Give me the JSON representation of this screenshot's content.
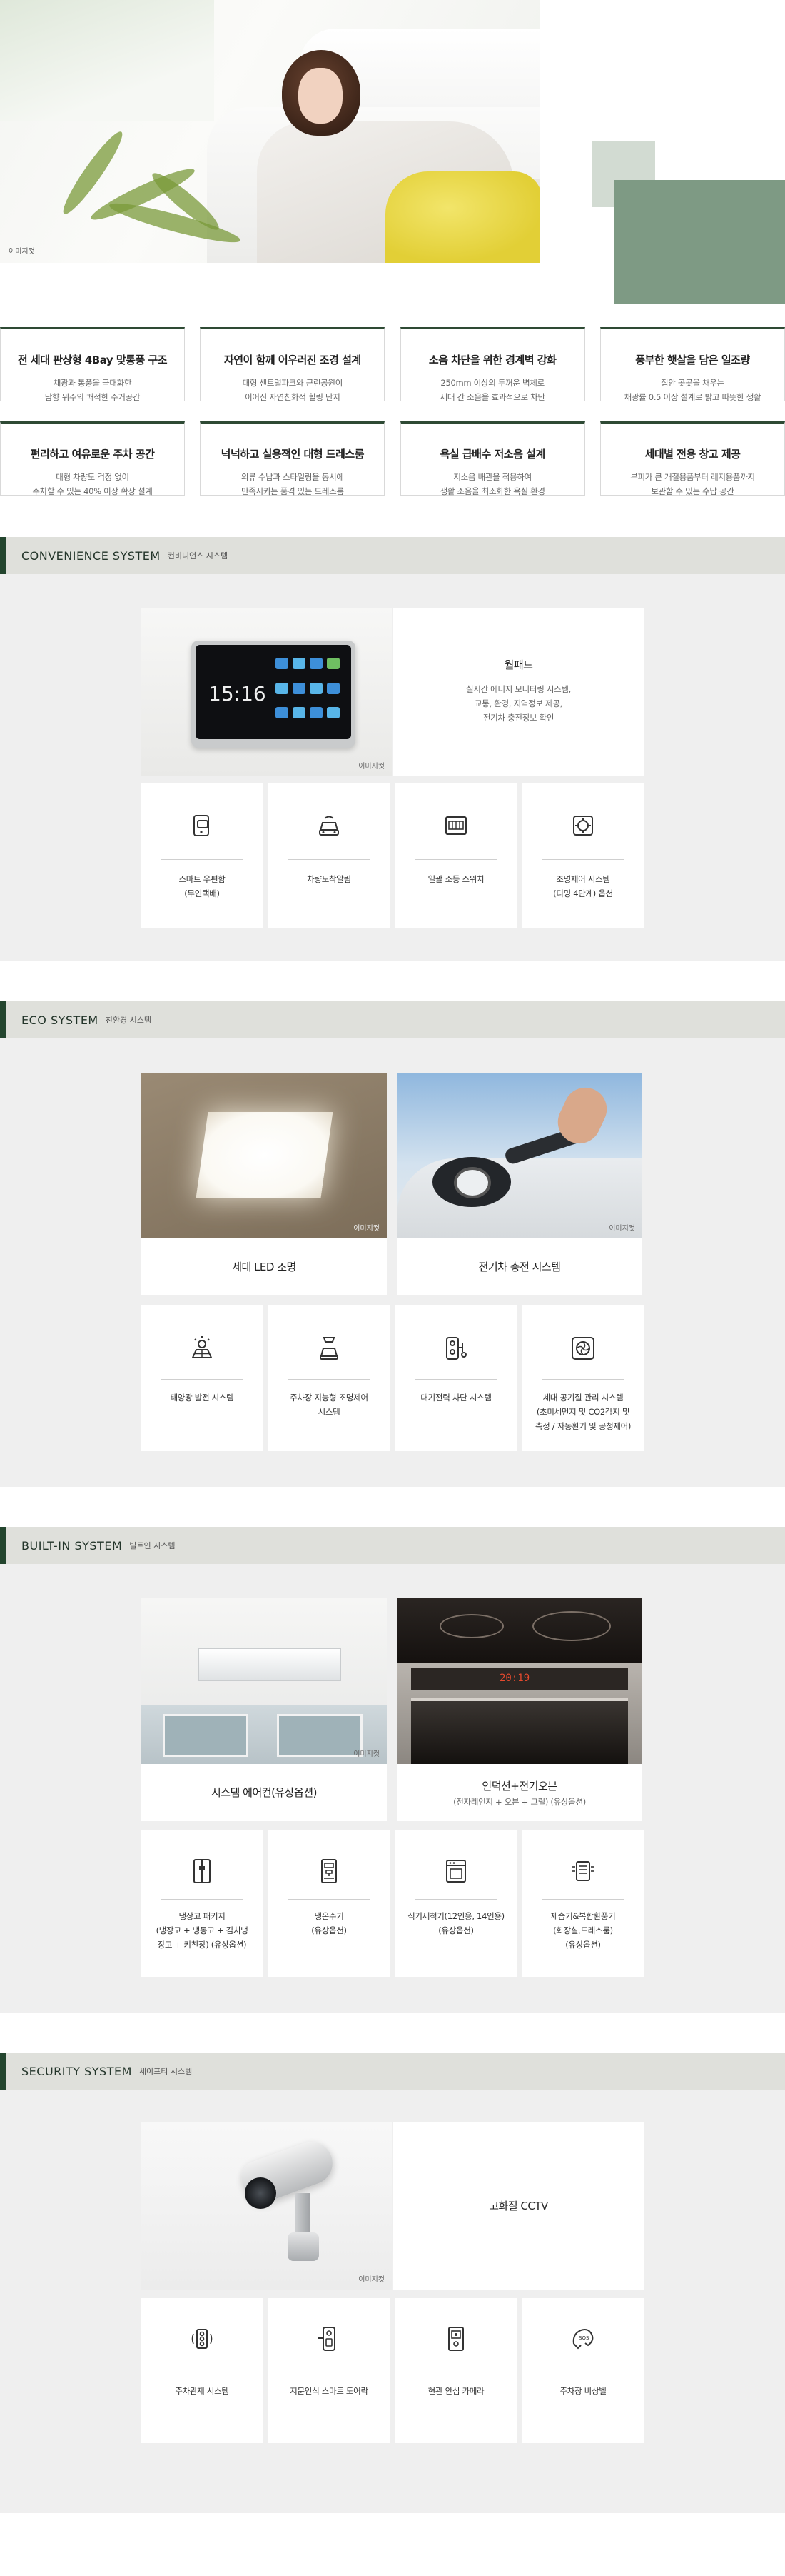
{
  "hero": {
    "image_caption": "이미지컷"
  },
  "features": {
    "row1": [
      {
        "title": "전 세대 판상형 4Bay 맞통풍 구조",
        "desc": "채광과 통풍을 극대화한\n남향 위주의 쾌적한 주거공간"
      },
      {
        "title": "자연이 함께 어우러진 조경 설계",
        "desc": "대형 센트럴파크와 근린공원이\n이어진 자연친화적 힐링 단지"
      },
      {
        "title": "소음 차단을 위한 경계벽 강화",
        "desc": "250mm 이상의 두꺼운 벽체로\n세대 간 소음을 효과적으로 차단"
      },
      {
        "title": "풍부한 햇살을 담은 일조량",
        "desc": "집안 곳곳을 채우는\n채광률 0.5 이상 설계로 밝고 따뜻한 생활"
      }
    ],
    "row2": [
      {
        "title": "편리하고 여유로운 주차 공간",
        "desc": "대형 차량도 걱정 없이\n주차할 수 있는 40% 이상 확장 설계"
      },
      {
        "title": "넉넉하고 실용적인 대형 드레스룸",
        "desc": "의류 수납과 스타일링을 동시에\n만족시키는 품격 있는 드레스룸"
      },
      {
        "title": "욕실 급배수 저소음 설계",
        "desc": "저소음 배관을 적용하여\n생활 소음을 최소화한 욕실 환경"
      },
      {
        "title": "세대별 전용 창고 제공",
        "desc": "부피가 큰 개절용품부터 레저용품까지\n보관할 수 있는 수납 공간"
      }
    ]
  },
  "convenience": {
    "title_en": "CONVENIENCE SYSTEM",
    "title_ko": "컨비니언스 시스템",
    "wallpad": {
      "screen_time": "15:16",
      "caption": "이미지컷",
      "title": "월패드",
      "desc": "실시간 에너지 모니터링 시스템,\n교통, 환경, 지역정보 제공,\n전기차 충전정보 확인"
    },
    "icons": [
      {
        "icon": "smart-mailbox-icon",
        "label": "스마트 우편함\n(무인택배)"
      },
      {
        "icon": "car-arrival-icon",
        "label": "차량도착알림"
      },
      {
        "icon": "standby-switch-icon",
        "label": "일괄 소등 스위치"
      },
      {
        "icon": "room-control-icon",
        "label": "조명제어 시스템\n(디밍 4단계) 옵션"
      }
    ]
  },
  "eco": {
    "title_en": "ECO SYSTEM",
    "title_ko": "친환경 시스템",
    "features": [
      {
        "label": "세대 LED 조명",
        "caption": "이미지컷"
      },
      {
        "label": "전기차 충전 시스템",
        "caption": "이미지컷"
      }
    ],
    "icons": [
      {
        "icon": "solar-power-icon",
        "label": "태양광 발전 시스템"
      },
      {
        "icon": "parking-lighting-icon",
        "label": "주차장 지능형 조명제어\n시스템"
      },
      {
        "icon": "standby-power-icon",
        "label": "대기전력 차단 시스템"
      },
      {
        "icon": "air-quality-icon",
        "label": "세대 공기질 관리 시스템\n(초미세먼지 및 CO2감지 및\n측정 / 자동환기 및 공청제어)"
      }
    ]
  },
  "builtin": {
    "title_en": "BUILT-IN SYSTEM",
    "title_ko": "빌트인 시스템",
    "features": [
      {
        "label": "시스템 에어컨(유상옵션)",
        "sub": "",
        "caption": "이미지컷"
      },
      {
        "label": "인덕션+전기오븐",
        "sub": "(전자레인지 + 오븐 + 그릴) (유상옵션)",
        "caption": ""
      }
    ],
    "oven_display": "20:19",
    "icons": [
      {
        "icon": "refrigerator-icon",
        "label": "냉장고 패키지\n(냉장고 + 냉동고 + 김치냉\n장고 + 키친장) (유상옵션)"
      },
      {
        "icon": "water-purifier-icon",
        "label": "냉온수기\n(유상옵션)"
      },
      {
        "icon": "dishwasher-icon",
        "label": "식기세척기(12인용, 14인용)\n(유상옵션)"
      },
      {
        "icon": "dehumidifier-icon",
        "label": "제습기&복합환풍기\n(화장실,드레스룸)\n(유상옵션)"
      }
    ]
  },
  "security": {
    "title_en": "SECURITY SYSTEM",
    "title_ko": "세이프티 시스템",
    "cctv": {
      "caption": "이미지컷",
      "label": "고화질 CCTV"
    },
    "icons": [
      {
        "icon": "parking-control-icon",
        "label": "주차관제 시스템"
      },
      {
        "icon": "door-lock-icon",
        "label": "지문인식 스마트 도어락"
      },
      {
        "icon": "entrance-camera-icon",
        "label": "현관 안심 카메라"
      },
      {
        "icon": "emergency-bell-icon",
        "label": "주차장 비상벨"
      }
    ]
  },
  "colors": {
    "accent": "#23452e",
    "bar": "#dfe0db",
    "section_bg": "#efefef",
    "hero_block": "#7e9a84"
  }
}
